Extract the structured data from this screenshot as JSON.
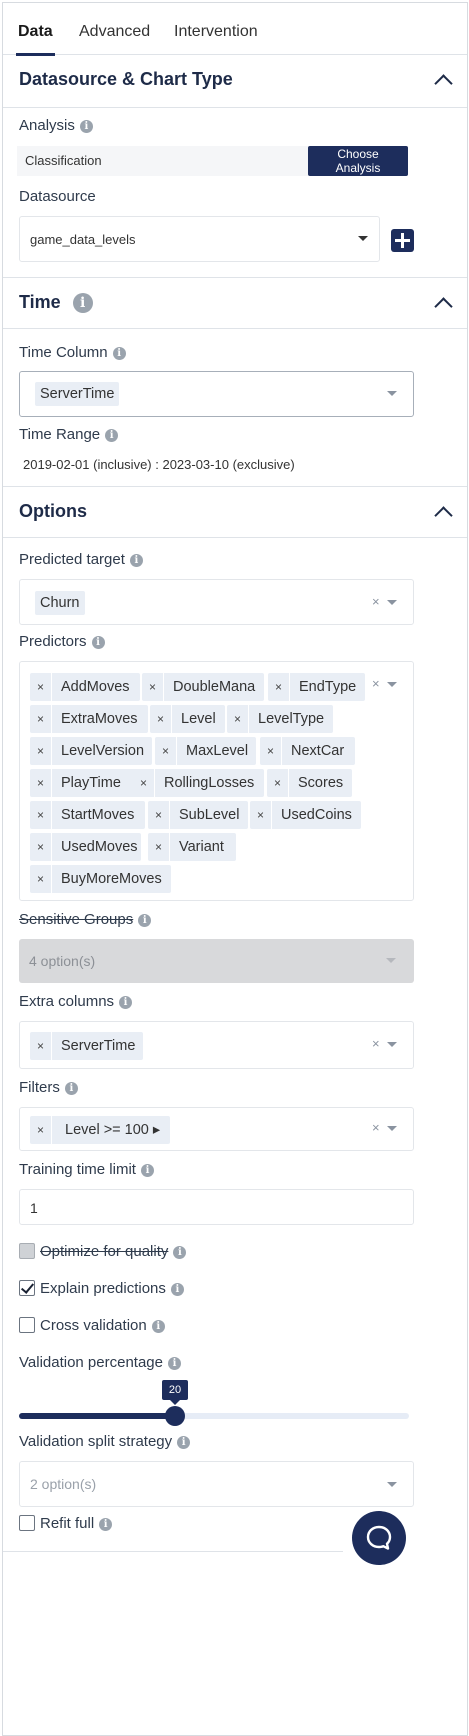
{
  "tabs": [
    {
      "label": "Data"
    },
    {
      "label": "Advanced"
    },
    {
      "label": "Intervention"
    }
  ],
  "sections": {
    "datasource": {
      "title": "Datasource & Chart Type"
    },
    "time": {
      "title": "Time"
    },
    "options": {
      "title": "Options"
    }
  },
  "analysis": {
    "label": "Analysis",
    "value": "Classification",
    "button": "Choose Analysis"
  },
  "datasource": {
    "label": "Datasource",
    "value": "game_data_levels"
  },
  "time_column": {
    "label": "Time Column",
    "value": "ServerTime"
  },
  "time_range": {
    "label": "Time Range",
    "value": "2019-02-01 (inclusive) : 2023-03-10 (exclusive)"
  },
  "predicted_target": {
    "label": "Predicted target",
    "value": "Churn"
  },
  "predictors": {
    "label": "Predictors",
    "items": [
      "AddMoves",
      "DoubleMana",
      "EndType",
      "ExtraMoves",
      "Level",
      "LevelType",
      "LevelVersion",
      "MaxLevel",
      "NextCar",
      "PlayTime",
      "RollingLosses",
      "Scores",
      "StartMoves",
      "SubLevel",
      "UsedCoins",
      "UsedMoves",
      "Variant",
      "BuyMoreMoves"
    ]
  },
  "sensitive_groups": {
    "label": "Sensitive Groups",
    "placeholder": "4 option(s)"
  },
  "extra_columns": {
    "label": "Extra columns",
    "items": [
      "ServerTime"
    ]
  },
  "filters": {
    "label": "Filters",
    "items": [
      "Level >= 100 ▸"
    ]
  },
  "training_time_limit": {
    "label": "Training time limit",
    "value": "1"
  },
  "checkboxes": {
    "optimize": {
      "label": "Optimize for quality",
      "checked": false,
      "disabled": true
    },
    "explain": {
      "label": "Explain predictions",
      "checked": true
    },
    "cross_validation": {
      "label": "Cross validation",
      "checked": false
    }
  },
  "validation_percentage": {
    "label": "Validation percentage",
    "value": "20",
    "fraction": 0.4
  },
  "validation_split": {
    "label": "Validation split strategy",
    "placeholder": "2 option(s)"
  },
  "refit_full": {
    "label": "Refit full",
    "checked": false
  },
  "clear_symbol": "×",
  "info_symbol": "i",
  "colors": {
    "primary": "#1d2d5c",
    "chip_bg": "#e9eef5",
    "disabled_bg": "#d8d9db"
  }
}
